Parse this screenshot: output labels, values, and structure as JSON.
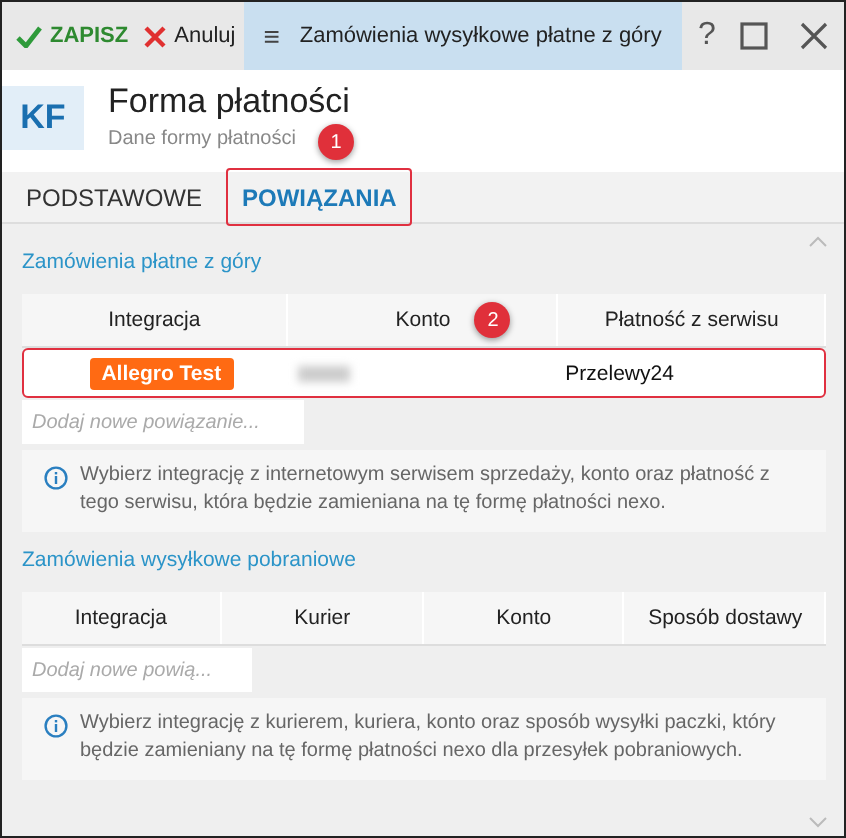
{
  "toolbar": {
    "save": "ZAPISZ",
    "cancel": "Anuluj",
    "menu_icon": "≡",
    "window_title": "Zamówienia wysyłkowe płatne z góry",
    "help": "?"
  },
  "header": {
    "badge": "KF",
    "title": "Forma płatności",
    "subtitle": "Dane formy płatności"
  },
  "tabs": [
    {
      "label": "PODSTAWOWE",
      "selected": false
    },
    {
      "label": "POWIĄZANIA",
      "selected": true,
      "annotation": "1"
    }
  ],
  "sections": [
    {
      "title": "Zamówienia płatne z góry",
      "columns": [
        "Integracja",
        "Konto",
        "Płatność z serwisu"
      ],
      "column_annotation": "2",
      "rows": [
        {
          "cells": [
            {
              "kind": "tag",
              "text": "Allegro Test"
            },
            {
              "kind": "redacted"
            },
            {
              "kind": "text",
              "text": "Przelewy24"
            }
          ],
          "highlighted": true
        }
      ],
      "add_placeholder": "Dodaj nowe powiązanie...",
      "info": "Wybierz integrację z internetowym serwisem sprzedaży, konto oraz płatność z tego serwisu, która będzie zamieniana na tę formę płatności nexo."
    },
    {
      "title": "Zamówienia wysyłkowe pobraniowe",
      "columns": [
        "Integracja",
        "Kurier",
        "Konto",
        "Sposób dostawy"
      ],
      "add_placeholder": "Dodaj nowe powią...",
      "info": "Wybierz integrację z kurierem, kuriera, konto oraz sposób wysyłki paczki, który będzie zamieniany na tę formę płatności nexo dla przesyłek pobraniowych."
    }
  ]
}
